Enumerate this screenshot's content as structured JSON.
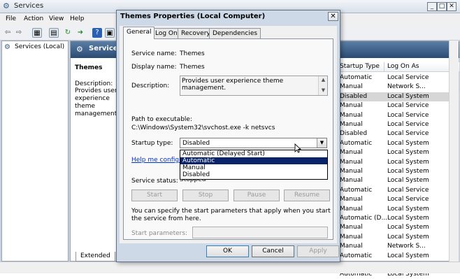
{
  "services_window": {
    "title": "Services",
    "menu": [
      "File",
      "Action",
      "View",
      "Help"
    ],
    "tree_item": "Services (Local)",
    "header_title": "Services",
    "selected_name": "Themes",
    "description_label": "Description:",
    "description_text": "Provides user experience theme management.",
    "columns": {
      "startup_type": "Startup Type",
      "log_on_as": "Log On As"
    },
    "rows": [
      {
        "startup": "Automatic",
        "logon": "Local Service",
        "selected": false
      },
      {
        "startup": "Manual",
        "logon": "Network S...",
        "selected": false
      },
      {
        "startup": "Disabled",
        "logon": "Local System",
        "selected": true
      },
      {
        "startup": "Manual",
        "logon": "Local Service",
        "selected": false
      },
      {
        "startup": "Manual",
        "logon": "Local Service",
        "selected": false
      },
      {
        "startup": "Manual",
        "logon": "Local Service",
        "selected": false
      },
      {
        "startup": "Disabled",
        "logon": "Local Service",
        "selected": false
      },
      {
        "startup": "Automatic",
        "logon": "Local System",
        "selected": false
      },
      {
        "startup": "Manual",
        "logon": "Local System",
        "selected": false
      },
      {
        "startup": "Manual",
        "logon": "Local System",
        "selected": false
      },
      {
        "startup": "Manual",
        "logon": "Local System",
        "selected": false
      },
      {
        "startup": "Manual",
        "logon": "Local System",
        "selected": false
      },
      {
        "startup": "Automatic",
        "logon": "Local Service",
        "selected": false
      },
      {
        "startup": "Manual",
        "logon": "Local Service",
        "selected": false
      },
      {
        "startup": "Manual",
        "logon": "Local System",
        "selected": false
      },
      {
        "startup": "Automatic (D...",
        "logon": "Local System",
        "selected": false
      },
      {
        "startup": "Manual",
        "logon": "Local System",
        "selected": false
      },
      {
        "startup": "Manual",
        "logon": "Local System",
        "selected": false
      },
      {
        "startup": "Manual",
        "logon": "Network S...",
        "selected": false
      },
      {
        "startup": "Automatic",
        "logon": "Local System",
        "selected": false
      },
      {
        "startup": "Automatic",
        "logon": "Local Service",
        "selected": false
      },
      {
        "startup": "Automatic",
        "logon": "Local System",
        "selected": false
      }
    ],
    "bottom_tabs": [
      "Extended",
      "S"
    ]
  },
  "dialog": {
    "title": "Themes Properties (Local Computer)",
    "close_glyph": "✕",
    "tabs": [
      "General",
      "Log On",
      "Recovery",
      "Dependencies"
    ],
    "service_name_label": "Service name:",
    "service_name": "Themes",
    "display_name_label": "Display name:",
    "display_name": "Themes",
    "description_label": "Description:",
    "description": "Provides user experience theme management.",
    "path_label": "Path to executable:",
    "path": "C:\\Windows\\System32\\svchost.exe -k netsvcs",
    "startup_type_label": "Startup type:",
    "startup_type_value": "Disabled",
    "startup_options": [
      "Automatic (Delayed Start)",
      "Automatic",
      "Manual",
      "Disabled"
    ],
    "highlighted_option": 1,
    "help_link": "Help me configure",
    "service_status_label": "Service status:",
    "service_status": "Stopped",
    "buttons": {
      "start": "Start",
      "stop": "Stop",
      "pause": "Pause",
      "resume": "Resume"
    },
    "info_text": "You can specify the start parameters that apply when you start the service from here.",
    "start_params_label": "Start parameters:",
    "start_params_value": "",
    "footer": {
      "ok": "OK",
      "cancel": "Cancel",
      "apply": "Apply"
    }
  },
  "colors": {
    "highlight": "#0a246a",
    "link": "#0033cc",
    "selected_row": "#d6d6d6"
  }
}
